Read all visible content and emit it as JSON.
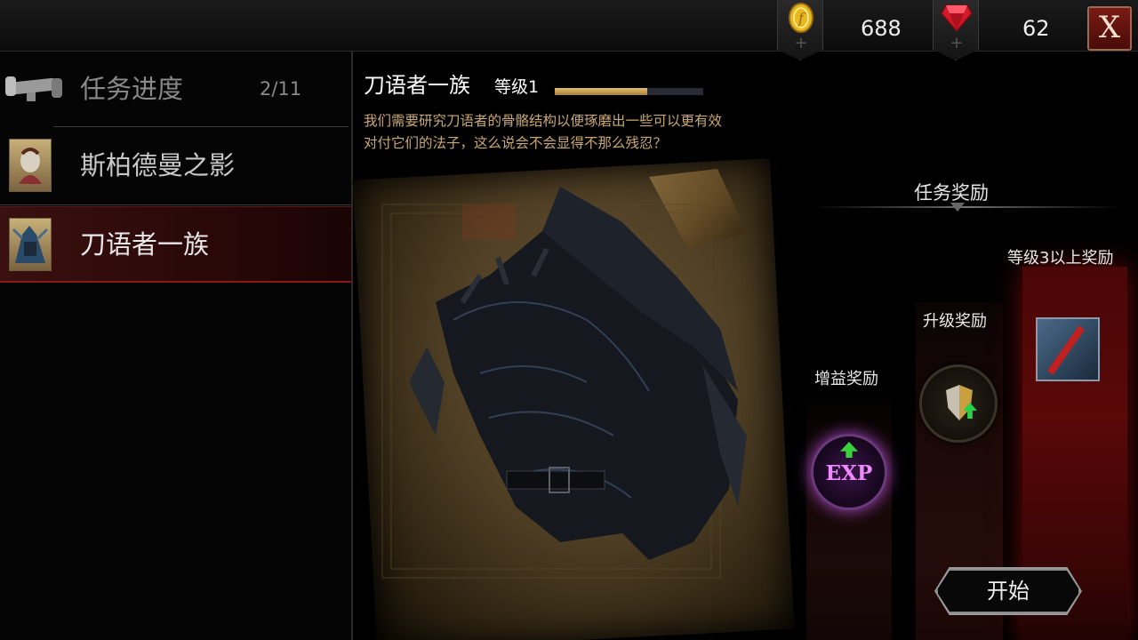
{
  "currency": {
    "gold": {
      "value": "688",
      "icon": "gold-coin-icon",
      "plus": "+"
    },
    "gems": {
      "value": "62",
      "icon": "red-gem-icon",
      "plus": "+"
    }
  },
  "close_label": "X",
  "quest_list": [
    {
      "label": "任务进度",
      "count": "2/11",
      "icon": "scroll-icon"
    },
    {
      "label": "斯柏德曼之影",
      "icon": "quest-portrait-icon"
    },
    {
      "label": "刀语者一族",
      "icon": "quest-portrait-icon",
      "selected": true
    }
  ],
  "quest": {
    "title": "刀语者一族",
    "level": "等级1",
    "progress": 0.62,
    "description": "我们需要研究刀语者的骨骼结构以便琢磨出一些可以更有效对付它们的法子，这么说会不会显得不那么残忍？"
  },
  "rewards": {
    "title": "任务奖励",
    "buff_label": "增益奖励",
    "exp_text": "EXP",
    "upgrade_label": "升级奖励",
    "level_label": "等级3以上奖励"
  },
  "start_label": "开始",
  "colors": {
    "accent_red": "#8a1a1a",
    "gold": "#c9a874",
    "exp_glow": "#b04ad0"
  }
}
